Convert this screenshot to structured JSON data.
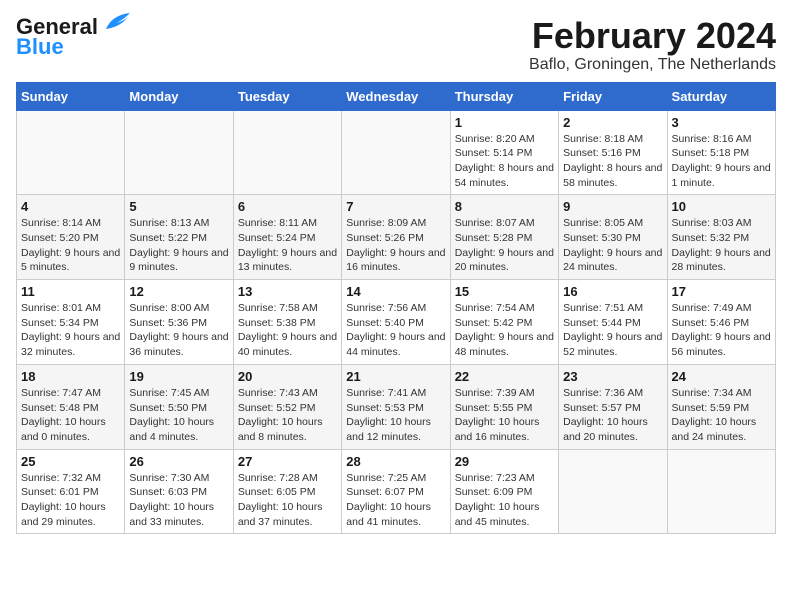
{
  "header": {
    "logo_line1": "General",
    "logo_line2": "Blue",
    "month": "February 2024",
    "location": "Baflo, Groningen, The Netherlands"
  },
  "days_of_week": [
    "Sunday",
    "Monday",
    "Tuesday",
    "Wednesday",
    "Thursday",
    "Friday",
    "Saturday"
  ],
  "weeks": [
    [
      {
        "day": "",
        "info": ""
      },
      {
        "day": "",
        "info": ""
      },
      {
        "day": "",
        "info": ""
      },
      {
        "day": "",
        "info": ""
      },
      {
        "day": "1",
        "info": "Sunrise: 8:20 AM\nSunset: 5:14 PM\nDaylight: 8 hours and 54 minutes."
      },
      {
        "day": "2",
        "info": "Sunrise: 8:18 AM\nSunset: 5:16 PM\nDaylight: 8 hours and 58 minutes."
      },
      {
        "day": "3",
        "info": "Sunrise: 8:16 AM\nSunset: 5:18 PM\nDaylight: 9 hours and 1 minute."
      }
    ],
    [
      {
        "day": "4",
        "info": "Sunrise: 8:14 AM\nSunset: 5:20 PM\nDaylight: 9 hours and 5 minutes."
      },
      {
        "day": "5",
        "info": "Sunrise: 8:13 AM\nSunset: 5:22 PM\nDaylight: 9 hours and 9 minutes."
      },
      {
        "day": "6",
        "info": "Sunrise: 8:11 AM\nSunset: 5:24 PM\nDaylight: 9 hours and 13 minutes."
      },
      {
        "day": "7",
        "info": "Sunrise: 8:09 AM\nSunset: 5:26 PM\nDaylight: 9 hours and 16 minutes."
      },
      {
        "day": "8",
        "info": "Sunrise: 8:07 AM\nSunset: 5:28 PM\nDaylight: 9 hours and 20 minutes."
      },
      {
        "day": "9",
        "info": "Sunrise: 8:05 AM\nSunset: 5:30 PM\nDaylight: 9 hours and 24 minutes."
      },
      {
        "day": "10",
        "info": "Sunrise: 8:03 AM\nSunset: 5:32 PM\nDaylight: 9 hours and 28 minutes."
      }
    ],
    [
      {
        "day": "11",
        "info": "Sunrise: 8:01 AM\nSunset: 5:34 PM\nDaylight: 9 hours and 32 minutes."
      },
      {
        "day": "12",
        "info": "Sunrise: 8:00 AM\nSunset: 5:36 PM\nDaylight: 9 hours and 36 minutes."
      },
      {
        "day": "13",
        "info": "Sunrise: 7:58 AM\nSunset: 5:38 PM\nDaylight: 9 hours and 40 minutes."
      },
      {
        "day": "14",
        "info": "Sunrise: 7:56 AM\nSunset: 5:40 PM\nDaylight: 9 hours and 44 minutes."
      },
      {
        "day": "15",
        "info": "Sunrise: 7:54 AM\nSunset: 5:42 PM\nDaylight: 9 hours and 48 minutes."
      },
      {
        "day": "16",
        "info": "Sunrise: 7:51 AM\nSunset: 5:44 PM\nDaylight: 9 hours and 52 minutes."
      },
      {
        "day": "17",
        "info": "Sunrise: 7:49 AM\nSunset: 5:46 PM\nDaylight: 9 hours and 56 minutes."
      }
    ],
    [
      {
        "day": "18",
        "info": "Sunrise: 7:47 AM\nSunset: 5:48 PM\nDaylight: 10 hours and 0 minutes."
      },
      {
        "day": "19",
        "info": "Sunrise: 7:45 AM\nSunset: 5:50 PM\nDaylight: 10 hours and 4 minutes."
      },
      {
        "day": "20",
        "info": "Sunrise: 7:43 AM\nSunset: 5:52 PM\nDaylight: 10 hours and 8 minutes."
      },
      {
        "day": "21",
        "info": "Sunrise: 7:41 AM\nSunset: 5:53 PM\nDaylight: 10 hours and 12 minutes."
      },
      {
        "day": "22",
        "info": "Sunrise: 7:39 AM\nSunset: 5:55 PM\nDaylight: 10 hours and 16 minutes."
      },
      {
        "day": "23",
        "info": "Sunrise: 7:36 AM\nSunset: 5:57 PM\nDaylight: 10 hours and 20 minutes."
      },
      {
        "day": "24",
        "info": "Sunrise: 7:34 AM\nSunset: 5:59 PM\nDaylight: 10 hours and 24 minutes."
      }
    ],
    [
      {
        "day": "25",
        "info": "Sunrise: 7:32 AM\nSunset: 6:01 PM\nDaylight: 10 hours and 29 minutes."
      },
      {
        "day": "26",
        "info": "Sunrise: 7:30 AM\nSunset: 6:03 PM\nDaylight: 10 hours and 33 minutes."
      },
      {
        "day": "27",
        "info": "Sunrise: 7:28 AM\nSunset: 6:05 PM\nDaylight: 10 hours and 37 minutes."
      },
      {
        "day": "28",
        "info": "Sunrise: 7:25 AM\nSunset: 6:07 PM\nDaylight: 10 hours and 41 minutes."
      },
      {
        "day": "29",
        "info": "Sunrise: 7:23 AM\nSunset: 6:09 PM\nDaylight: 10 hours and 45 minutes."
      },
      {
        "day": "",
        "info": ""
      },
      {
        "day": "",
        "info": ""
      }
    ]
  ]
}
